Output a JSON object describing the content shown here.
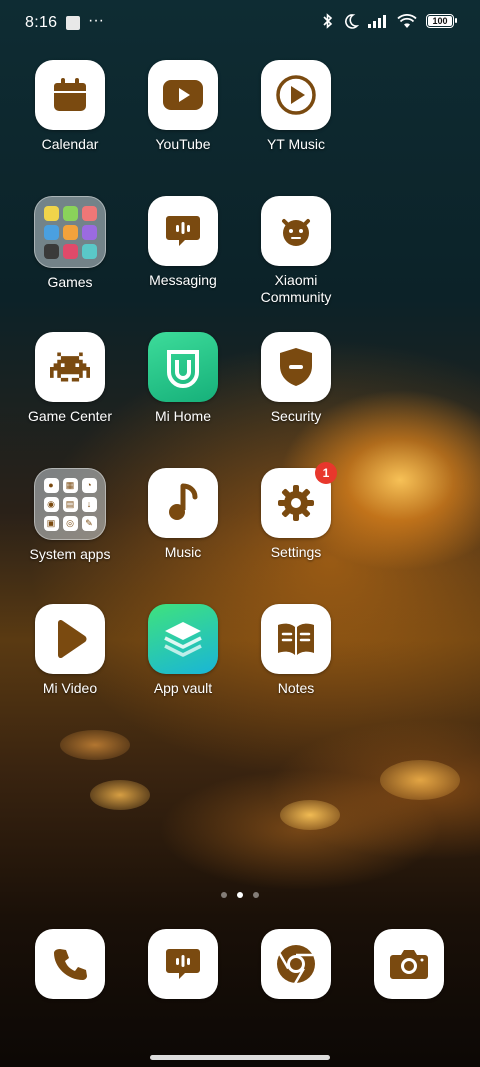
{
  "status_bar": {
    "time": "8:16",
    "battery": "100",
    "icons": [
      "notification-square-icon",
      "more-dots-icon",
      "bluetooth-icon",
      "moon-icon",
      "signal-icon",
      "wifi-icon",
      "battery-icon"
    ]
  },
  "apps": [
    {
      "id": "calendar",
      "label": "Calendar",
      "icon": "calendar-icon"
    },
    {
      "id": "youtube",
      "label": "YouTube",
      "icon": "youtube-icon"
    },
    {
      "id": "yt-music",
      "label": "YT Music",
      "icon": "yt-music-icon"
    },
    {
      "id": "games",
      "label": "Games",
      "icon": "games-folder-icon"
    },
    {
      "id": "messaging",
      "label": "Messaging",
      "icon": "messaging-icon"
    },
    {
      "id": "xiaomi-community",
      "label": "Xiaomi\nCommunity",
      "icon": "xiaomi-community-icon"
    },
    {
      "id": "game-center",
      "label": "Game Center",
      "icon": "space-invader-icon"
    },
    {
      "id": "mi-home",
      "label": "Mi Home",
      "icon": "mi-home-icon"
    },
    {
      "id": "security",
      "label": "Security",
      "icon": "shield-icon"
    },
    {
      "id": "system-apps",
      "label": "System apps",
      "icon": "system-apps-folder-icon"
    },
    {
      "id": "music",
      "label": "Music",
      "icon": "music-note-icon"
    },
    {
      "id": "settings",
      "label": "Settings",
      "icon": "gear-icon",
      "badge": "1"
    },
    {
      "id": "mi-video",
      "label": "Mi Video",
      "icon": "play-icon"
    },
    {
      "id": "app-vault",
      "label": "App vault",
      "icon": "layers-icon"
    },
    {
      "id": "notes",
      "label": "Notes",
      "icon": "book-icon"
    }
  ],
  "dock": [
    {
      "id": "phone",
      "icon": "phone-icon"
    },
    {
      "id": "messages",
      "icon": "messaging-icon"
    },
    {
      "id": "chrome",
      "icon": "chrome-icon"
    },
    {
      "id": "camera",
      "icon": "camera-icon"
    }
  ],
  "page_indicator": {
    "pages": 3,
    "current": 2
  },
  "colors": {
    "icon_accent": "#7a4a10",
    "badge": "#e8372c"
  }
}
